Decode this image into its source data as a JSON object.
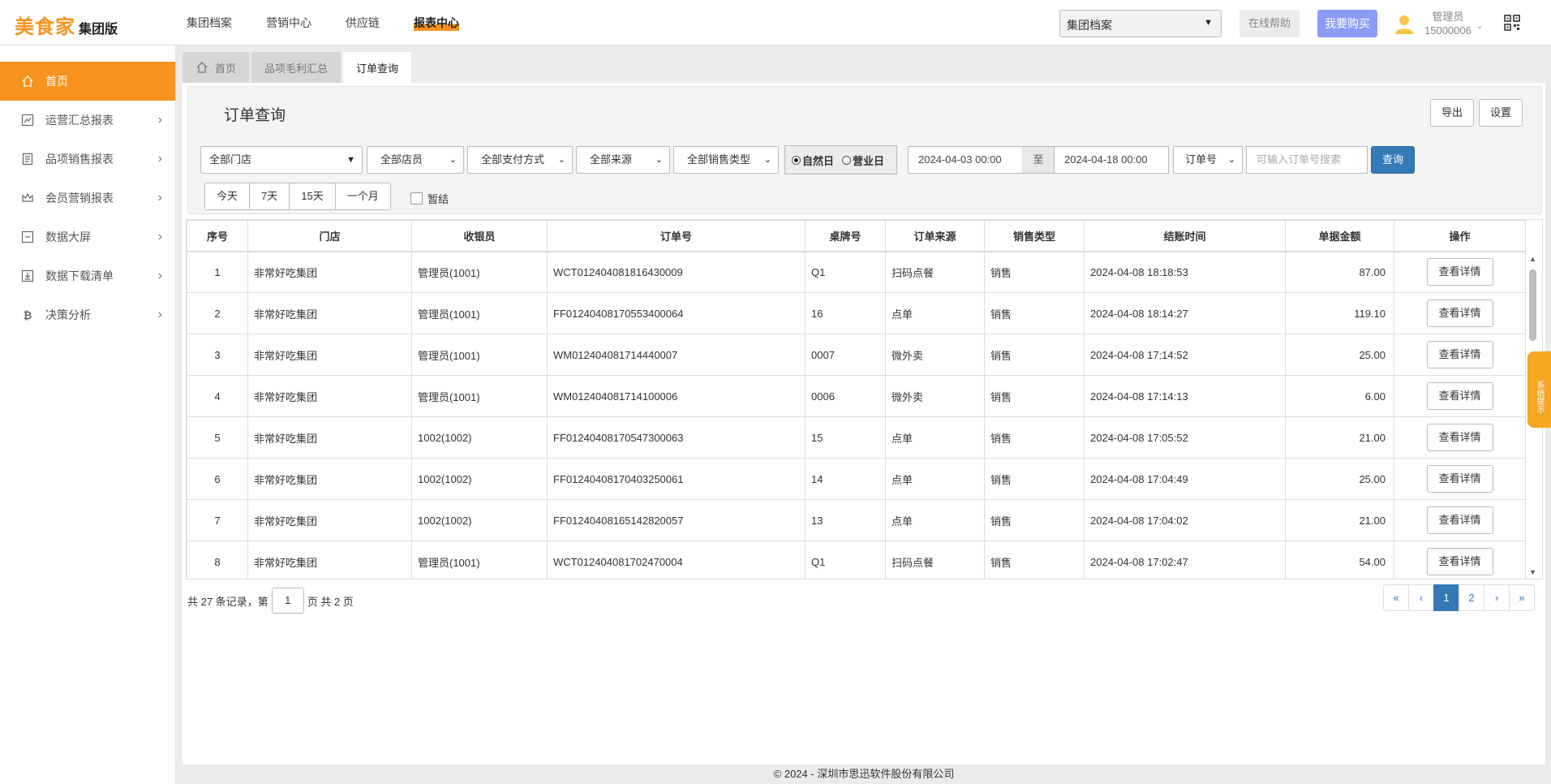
{
  "header": {
    "brand": "美食家",
    "edition": "集团版",
    "nav": [
      "集团档案",
      "营销中心",
      "供应链",
      "报表中心"
    ],
    "group_select": "集团档案",
    "help_label": "在线帮助",
    "buy_label": "我要购买",
    "user_role": "管理员",
    "user_id": "15000006"
  },
  "sidebar": {
    "items": [
      {
        "label": "首页"
      },
      {
        "label": "运营汇总报表"
      },
      {
        "label": "品项销售报表"
      },
      {
        "label": "会员营销报表"
      },
      {
        "label": "数据大屏"
      },
      {
        "label": "数据下载清单"
      },
      {
        "label": "决策分析"
      }
    ]
  },
  "tabs": [
    "首页",
    "品项毛利汇总",
    "订单查询"
  ],
  "query": {
    "title": "订单查询",
    "export_label": "导出",
    "settings_label": "设置",
    "store_select": "全部门店",
    "staff_select": "全部店员",
    "payment_select": "全部支付方式",
    "source_select": "全部来源",
    "sales_type_select": "全部销售类型",
    "radio_natural": "自然日",
    "radio_business": "营业日",
    "date_from": "2024-04-03 00:00",
    "to_label": "至",
    "date_to": "2024-04-18 00:00",
    "search_type": "订单号",
    "search_placeholder": "可输入订单号搜索",
    "query_label": "查询",
    "quick": [
      "今天",
      "7天",
      "15天",
      "一个月"
    ],
    "settle_label": "暂结"
  },
  "table": {
    "headers": [
      "序号",
      "门店",
      "收银员",
      "订单号",
      "桌牌号",
      "订单来源",
      "销售类型",
      "结账时间",
      "单据金额",
      "操作"
    ],
    "detail_label": "查看详情",
    "rows": [
      {
        "no": "1",
        "store": "非常好吃集团",
        "cashier": "管理员(1001)",
        "order": "WCT012404081816430009",
        "table": "Q1",
        "source": "扫码点餐",
        "type": "销售",
        "time": "2024-04-08 18:18:53",
        "amount": "87.00"
      },
      {
        "no": "2",
        "store": "非常好吃集团",
        "cashier": "管理员(1001)",
        "order": "FF01240408170553400064",
        "table": "16",
        "source": "点单",
        "type": "销售",
        "time": "2024-04-08 18:14:27",
        "amount": "119.10"
      },
      {
        "no": "3",
        "store": "非常好吃集团",
        "cashier": "管理员(1001)",
        "order": "WM012404081714440007",
        "table": "0007",
        "source": "微外卖",
        "type": "销售",
        "time": "2024-04-08 17:14:52",
        "amount": "25.00"
      },
      {
        "no": "4",
        "store": "非常好吃集团",
        "cashier": "管理员(1001)",
        "order": "WM012404081714100006",
        "table": "0006",
        "source": "微外卖",
        "type": "销售",
        "time": "2024-04-08 17:14:13",
        "amount": "6.00"
      },
      {
        "no": "5",
        "store": "非常好吃集团",
        "cashier": "1002(1002)",
        "order": "FF01240408170547300063",
        "table": "15",
        "source": "点单",
        "type": "销售",
        "time": "2024-04-08 17:05:52",
        "amount": "21.00"
      },
      {
        "no": "6",
        "store": "非常好吃集团",
        "cashier": "1002(1002)",
        "order": "FF01240408170403250061",
        "table": "14",
        "source": "点单",
        "type": "销售",
        "time": "2024-04-08 17:04:49",
        "amount": "25.00"
      },
      {
        "no": "7",
        "store": "非常好吃集团",
        "cashier": "1002(1002)",
        "order": "FF01240408165142820057",
        "table": "13",
        "source": "点单",
        "type": "销售",
        "time": "2024-04-08 17:04:02",
        "amount": "21.00"
      },
      {
        "no": "8",
        "store": "非常好吃集团",
        "cashier": "管理员(1001)",
        "order": "WCT012404081702470004",
        "table": "Q1",
        "source": "扫码点餐",
        "type": "销售",
        "time": "2024-04-08 17:02:47",
        "amount": "54.00"
      }
    ]
  },
  "pagination": {
    "prefix": "共 27 条记录，第",
    "current": "1",
    "suffix": "页 共 2 页",
    "buttons": [
      "«",
      "‹",
      "1",
      "2",
      "›",
      "»"
    ]
  },
  "sys_tip": "系统提示",
  "footer": "© 2024 - 深圳市思迅软件股份有限公司",
  "colors": {
    "accent": "#f7931e",
    "primary": "#337ab7",
    "buy": "#8d9bf8"
  }
}
